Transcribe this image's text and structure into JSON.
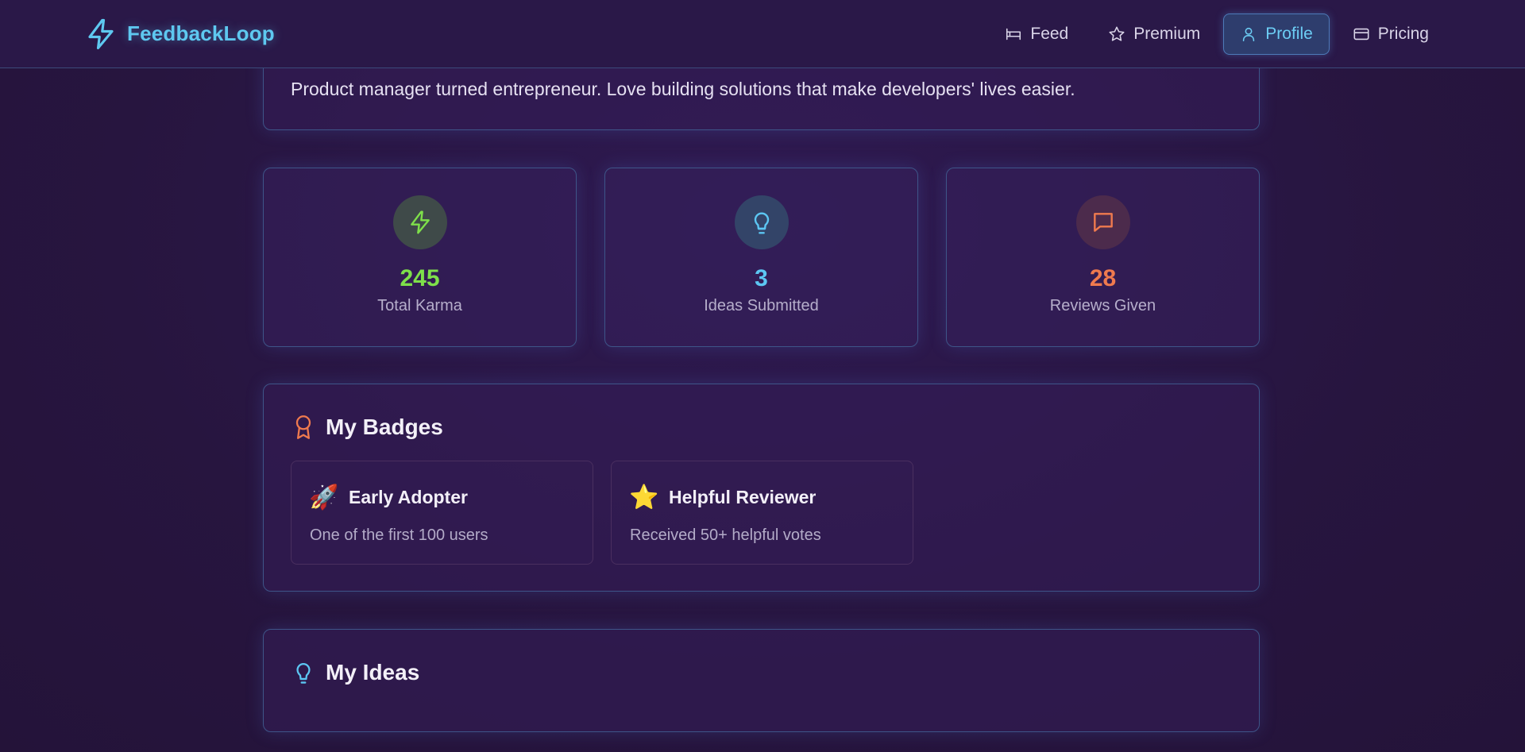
{
  "app": {
    "name": "FeedbackLoop"
  },
  "nav": [
    {
      "label": "Feed",
      "icon": "bed-icon"
    },
    {
      "label": "Premium",
      "icon": "star-icon"
    },
    {
      "label": "Profile",
      "icon": "user-icon",
      "active": true
    },
    {
      "label": "Pricing",
      "icon": "card-icon"
    }
  ],
  "profile": {
    "bio": "Product manager turned entrepreneur. Love building solutions that make developers' lives easier."
  },
  "stats": [
    {
      "value": "245",
      "label": "Total Karma",
      "icon": "lightning-icon",
      "color": "#7ee04a"
    },
    {
      "value": "3",
      "label": "Ideas Submitted",
      "icon": "lightbulb-icon",
      "color": "#5cc6f2"
    },
    {
      "value": "28",
      "label": "Reviews Given",
      "icon": "message-icon",
      "color": "#ef7a4e"
    }
  ],
  "badges": {
    "title": "My Badges",
    "items": [
      {
        "emoji": "🚀",
        "name": "Early Adopter",
        "description": "One of the first 100 users"
      },
      {
        "emoji": "⭐",
        "name": "Helpful Reviewer",
        "description": "Received 50+ helpful votes"
      }
    ]
  },
  "ideas": {
    "title": "My Ideas"
  },
  "colors": {
    "accent": "#5ec8f0",
    "background": "#2a1748",
    "badge_icon": "#ef7a4e"
  }
}
